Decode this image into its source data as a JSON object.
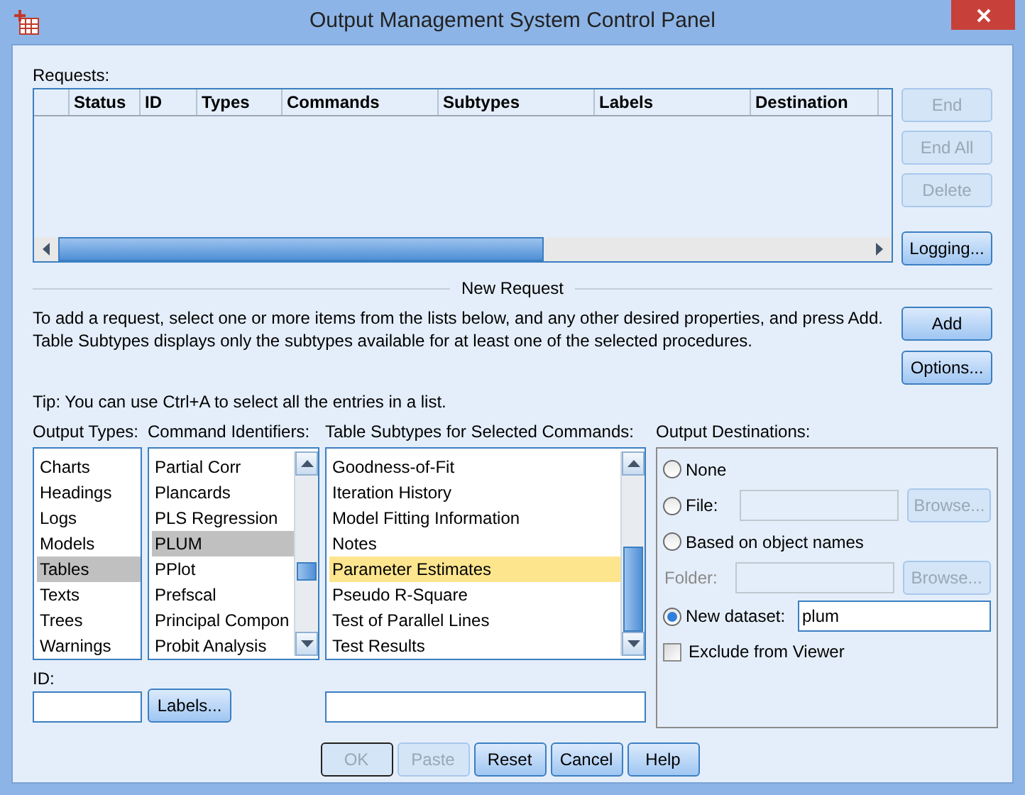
{
  "window": {
    "title": "Output Management System Control Panel"
  },
  "requests": {
    "label": "Requests:",
    "columns": [
      "Status",
      "ID",
      "Types",
      "Commands",
      "Subtypes",
      "Labels",
      "Destination"
    ],
    "buttons": [
      {
        "label": "End",
        "disabled": true
      },
      {
        "label": "End All",
        "disabled": true
      },
      {
        "label": "Delete",
        "disabled": true
      },
      {
        "label": "Logging...",
        "disabled": false
      }
    ]
  },
  "new_request": {
    "heading": "New Request",
    "description": "To add a request, select one or more items from the lists below, and any other desired properties, and press Add. Table Subtypes displays only the subtypes available for at least one of the selected procedures.",
    "tip": "Tip: You can use Ctrl+A to select all the entries in a list.",
    "buttons": [
      {
        "label": "Add",
        "disabled": false
      },
      {
        "label": "Options...",
        "disabled": false
      }
    ]
  },
  "output_types": {
    "label": "Output Types:",
    "focused": false,
    "items": [
      {
        "label": "Charts",
        "selected": false
      },
      {
        "label": "Headings",
        "selected": false
      },
      {
        "label": "Logs",
        "selected": false
      },
      {
        "label": "Models",
        "selected": false
      },
      {
        "label": "Tables",
        "selected": true
      },
      {
        "label": "Texts",
        "selected": false
      },
      {
        "label": "Trees",
        "selected": false
      },
      {
        "label": "Warnings",
        "selected": false
      }
    ]
  },
  "command_identifiers": {
    "label": "Command Identifiers:",
    "focused": false,
    "items": [
      {
        "label": "Partial Corr",
        "selected": false
      },
      {
        "label": "Plancards",
        "selected": false
      },
      {
        "label": "PLS Regression",
        "selected": false
      },
      {
        "label": "PLUM",
        "selected": true
      },
      {
        "label": "PPlot",
        "selected": false
      },
      {
        "label": "Prefscal",
        "selected": false
      },
      {
        "label": "Principal Compon",
        "selected": false
      },
      {
        "label": "Probit Analysis",
        "selected": false
      }
    ]
  },
  "table_subtypes": {
    "label": "Table Subtypes for Selected Commands:",
    "focused": true,
    "items": [
      {
        "label": "Goodness-of-Fit",
        "selected": false
      },
      {
        "label": "Iteration History",
        "selected": false
      },
      {
        "label": "Model Fitting Information",
        "selected": false
      },
      {
        "label": "Notes",
        "selected": false
      },
      {
        "label": "Parameter Estimates",
        "selected": true
      },
      {
        "label": "Pseudo R-Square",
        "selected": false
      },
      {
        "label": "Test of Parallel Lines",
        "selected": false
      },
      {
        "label": "Test Results",
        "selected": false
      }
    ]
  },
  "output_destinations": {
    "label": "Output Destinations:",
    "options": [
      {
        "kind": "radio",
        "label": "None",
        "selected": false
      },
      {
        "kind": "radio-field",
        "label": "File:",
        "selected": false,
        "disabled": true,
        "browse": "Browse..."
      },
      {
        "kind": "radio",
        "label": "Based on object names",
        "selected": false
      },
      {
        "kind": "field",
        "label": "Folder:",
        "disabled": true,
        "browse": "Browse..."
      },
      {
        "kind": "radio-field",
        "label": "New dataset:",
        "selected": true,
        "disabled": false,
        "value": "plum"
      },
      {
        "kind": "checkbox",
        "label": "Exclude from Viewer",
        "checked": false
      }
    ]
  },
  "id": {
    "label": "ID:"
  },
  "labels_button": {
    "label": "Labels...",
    "disabled": false
  },
  "footer_buttons": [
    {
      "label": "OK",
      "disabled": true,
      "default": true
    },
    {
      "label": "Paste",
      "disabled": true,
      "default": false
    },
    {
      "label": "Reset",
      "disabled": false,
      "default": false
    },
    {
      "label": "Cancel",
      "disabled": false,
      "default": false
    },
    {
      "label": "Help",
      "disabled": false,
      "default": false
    }
  ]
}
